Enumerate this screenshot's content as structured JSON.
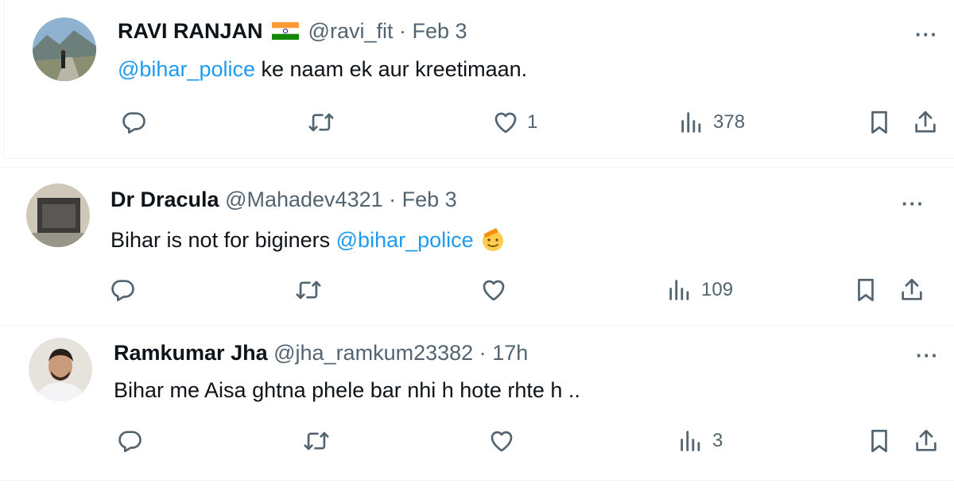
{
  "tweets": [
    {
      "name": "RAVI RANJAN",
      "handle": "@ravi_fit",
      "sep": "·",
      "date": "Feb 3",
      "mention": "@bihar_police",
      "text": " ke naam ek aur kreetimaan.",
      "likes": "1",
      "views": "378",
      "icons": [
        "reply-icon",
        "retweet-icon",
        "like-icon",
        "views-icon",
        "bookmark-icon",
        "share-icon",
        "more-icon",
        "india-flag-icon"
      ]
    },
    {
      "name": "Dr Dracula",
      "handle": "@Mahadev4321",
      "sep": "·",
      "date": "Feb 3",
      "text_before": "Bihar is not for biginers ",
      "mention": "@bihar_police",
      "likes": "",
      "views": "109",
      "icons": [
        "reply-icon",
        "retweet-icon",
        "like-icon",
        "views-icon",
        "bookmark-icon",
        "share-icon",
        "more-icon",
        "saluting-face-emoji-icon"
      ]
    },
    {
      "name": "Ramkumar Jha",
      "handle": "@jha_ramkum23382",
      "sep": "·",
      "date": "17h",
      "text": "Bihar me Aisa ghtna phele bar nhi h hote rhte h ..",
      "likes": "",
      "views": "3",
      "icons": [
        "reply-icon",
        "retweet-icon",
        "like-icon",
        "views-icon",
        "bookmark-icon",
        "share-icon",
        "more-icon"
      ]
    }
  ],
  "ui": {
    "more_label": "···"
  },
  "colors": {
    "link": "#1d9bf0",
    "muted": "#536471",
    "text": "#0f1419",
    "divider": "#eff3f4"
  }
}
